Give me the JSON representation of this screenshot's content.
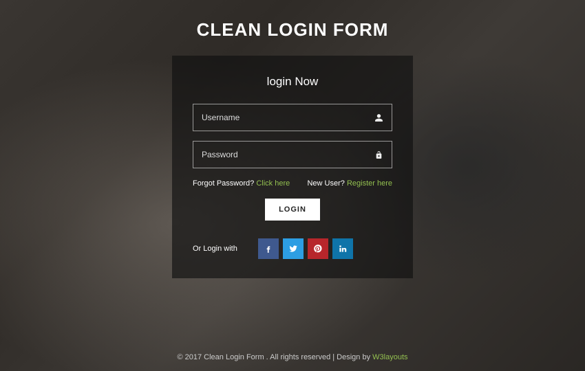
{
  "header": {
    "title": "CLEAN LOGIN FORM"
  },
  "panel": {
    "heading": "login Now",
    "username_placeholder": "Username",
    "password_placeholder": "Password",
    "forgot_label": "Forgot Password?",
    "forgot_link_text": "Click here",
    "newuser_label": "New User?",
    "register_link_text": "Register here",
    "login_button": "LOGIN",
    "social_label": "Or Login with",
    "social": {
      "facebook": "facebook",
      "twitter": "twitter",
      "pinterest": "pinterest",
      "linkedin": "linkedin"
    }
  },
  "footer": {
    "text": "© 2017 Clean Login Form . All rights reserved | Design by ",
    "link_text": "W3layouts"
  },
  "colors": {
    "accent": "#8fc43f",
    "facebook": "#3b5998",
    "twitter": "#1da1f2",
    "pinterest": "#cb2027",
    "linkedin": "#0077b5"
  }
}
